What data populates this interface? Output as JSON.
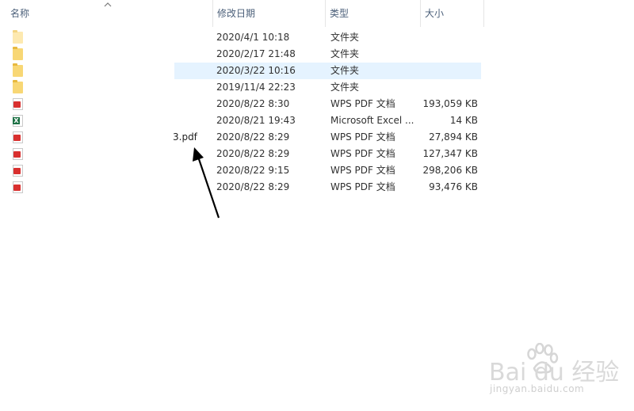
{
  "header": {
    "name": "名称",
    "date": "修改日期",
    "type": "类型",
    "size": "大小"
  },
  "rows": [
    {
      "icon": "folder-light-icon",
      "name": "",
      "date": "2020/4/1 10:18",
      "type": "文件夹",
      "size": ""
    },
    {
      "icon": "folder-icon",
      "name": "",
      "date": "2020/2/17 21:48",
      "type": "文件夹",
      "size": ""
    },
    {
      "icon": "folder-icon",
      "name": "",
      "date": "2020/3/22 10:16",
      "type": "文件夹",
      "size": "",
      "selected": true
    },
    {
      "icon": "folder-icon",
      "name": "",
      "date": "2019/11/4 22:23",
      "type": "文件夹",
      "size": ""
    },
    {
      "icon": "pdf-icon",
      "name": "",
      "date": "2020/8/22 8:30",
      "type": "WPS PDF 文档",
      "size": "193,059 KB"
    },
    {
      "icon": "excel-icon",
      "name": "",
      "date": "2020/8/21 19:43",
      "type": "Microsoft Excel ...",
      "size": "14 KB"
    },
    {
      "icon": "pdf-icon",
      "name": "3.pdf",
      "date": "2020/8/22 8:29",
      "type": "WPS PDF 文档",
      "size": "27,894 KB"
    },
    {
      "icon": "pdf-icon",
      "name": "",
      "date": "2020/8/22 8:29",
      "type": "WPS PDF 文档",
      "size": "127,347 KB"
    },
    {
      "icon": "pdf-icon",
      "name": "",
      "date": "2020/8/22 9:15",
      "type": "WPS PDF 文档",
      "size": "298,206 KB"
    },
    {
      "icon": "pdf-icon",
      "name": "",
      "date": "2020/8/22 8:29",
      "type": "WPS PDF 文档",
      "size": "93,476 KB"
    }
  ],
  "watermark": {
    "logo": "Bai du 经验",
    "url": "jingyan.baidu.com"
  },
  "colors": {
    "header_text": "#4c607a",
    "selection": "#e5f3ff",
    "folder": "#f8d775",
    "pdf": "#d9302f",
    "excel": "#1d7145"
  }
}
